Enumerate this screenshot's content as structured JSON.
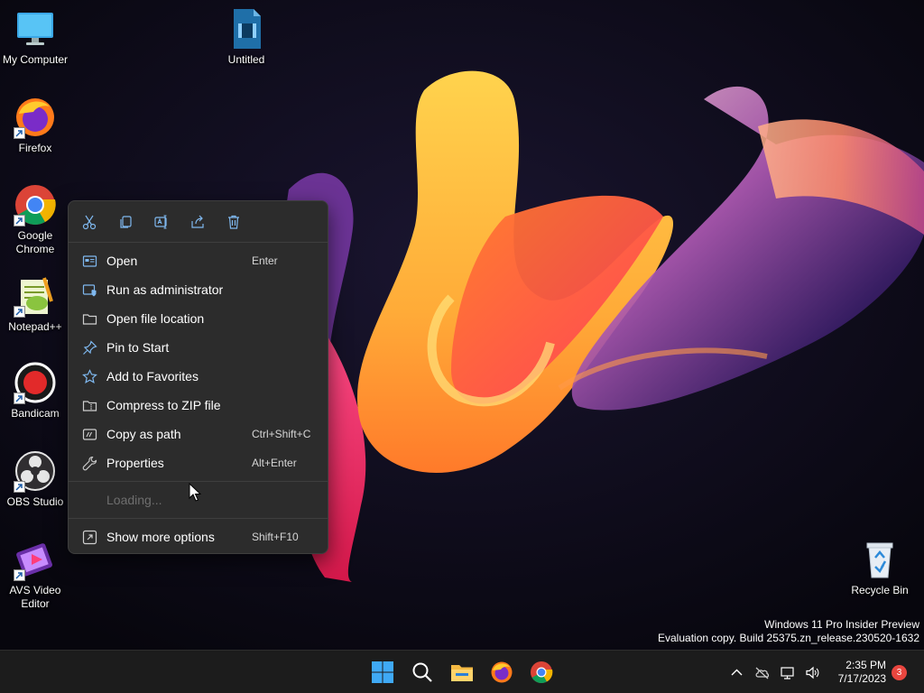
{
  "desktop": {
    "icons": [
      {
        "label": "My Computer",
        "icon": "monitor-icon"
      },
      {
        "label": "Untitled",
        "icon": "video-file-icon"
      },
      {
        "label": "Firefox",
        "icon": "firefox-icon"
      },
      {
        "label": "Google Chrome",
        "icon": "chrome-icon"
      },
      {
        "label": "Notepad++",
        "icon": "notepadpp-icon"
      },
      {
        "label": "Bandicam",
        "icon": "bandicam-icon"
      },
      {
        "label": "OBS Studio",
        "icon": "obs-icon"
      },
      {
        "label": "AVS Video Editor",
        "icon": "avs-icon"
      },
      {
        "label": "Recycle Bin",
        "icon": "recycle-bin-icon"
      }
    ]
  },
  "context_menu": {
    "actions": [
      {
        "name": "Cut",
        "icon": "cut-icon"
      },
      {
        "name": "Copy",
        "icon": "copy-icon"
      },
      {
        "name": "Rename",
        "icon": "rename-icon"
      },
      {
        "name": "Share",
        "icon": "share-icon"
      },
      {
        "name": "Delete",
        "icon": "delete-icon"
      }
    ],
    "items": [
      {
        "label": "Open",
        "shortcut": "Enter",
        "icon": "open-icon"
      },
      {
        "label": "Run as administrator",
        "shortcut": "",
        "icon": "admin-shield-icon"
      },
      {
        "label": "Open file location",
        "shortcut": "",
        "icon": "folder-icon"
      },
      {
        "label": "Pin to Start",
        "shortcut": "",
        "icon": "pin-icon"
      },
      {
        "label": "Add to Favorites",
        "shortcut": "",
        "icon": "star-icon"
      },
      {
        "label": "Compress to ZIP file",
        "shortcut": "",
        "icon": "zip-icon"
      },
      {
        "label": "Copy as path",
        "shortcut": "Ctrl+Shift+C",
        "icon": "path-icon"
      },
      {
        "label": "Properties",
        "shortcut": "Alt+Enter",
        "icon": "wrench-icon"
      }
    ],
    "loading_text": "Loading...",
    "more": {
      "label": "Show more options",
      "shortcut": "Shift+F10",
      "icon": "more-options-icon"
    }
  },
  "watermark": {
    "line1": "Windows 11 Pro Insider Preview",
    "line2": "Evaluation copy. Build 25375.zn_release.230520-1632"
  },
  "taskbar": {
    "pinned": [
      {
        "name": "Start",
        "icon": "windows-logo-icon"
      },
      {
        "name": "Search",
        "icon": "search-icon"
      },
      {
        "name": "File Explorer",
        "icon": "file-explorer-icon"
      },
      {
        "name": "Firefox",
        "icon": "firefox-icon"
      },
      {
        "name": "Google Chrome",
        "icon": "chrome-icon"
      }
    ],
    "time": "2:35 PM",
    "date": "7/17/2023",
    "notification_count": "3"
  },
  "colors": {
    "menu_bg": "#2c2c2c",
    "taskbar_bg": "#1c1c1c",
    "accent": "#0078d4",
    "notification_badge": "#e9463f"
  }
}
